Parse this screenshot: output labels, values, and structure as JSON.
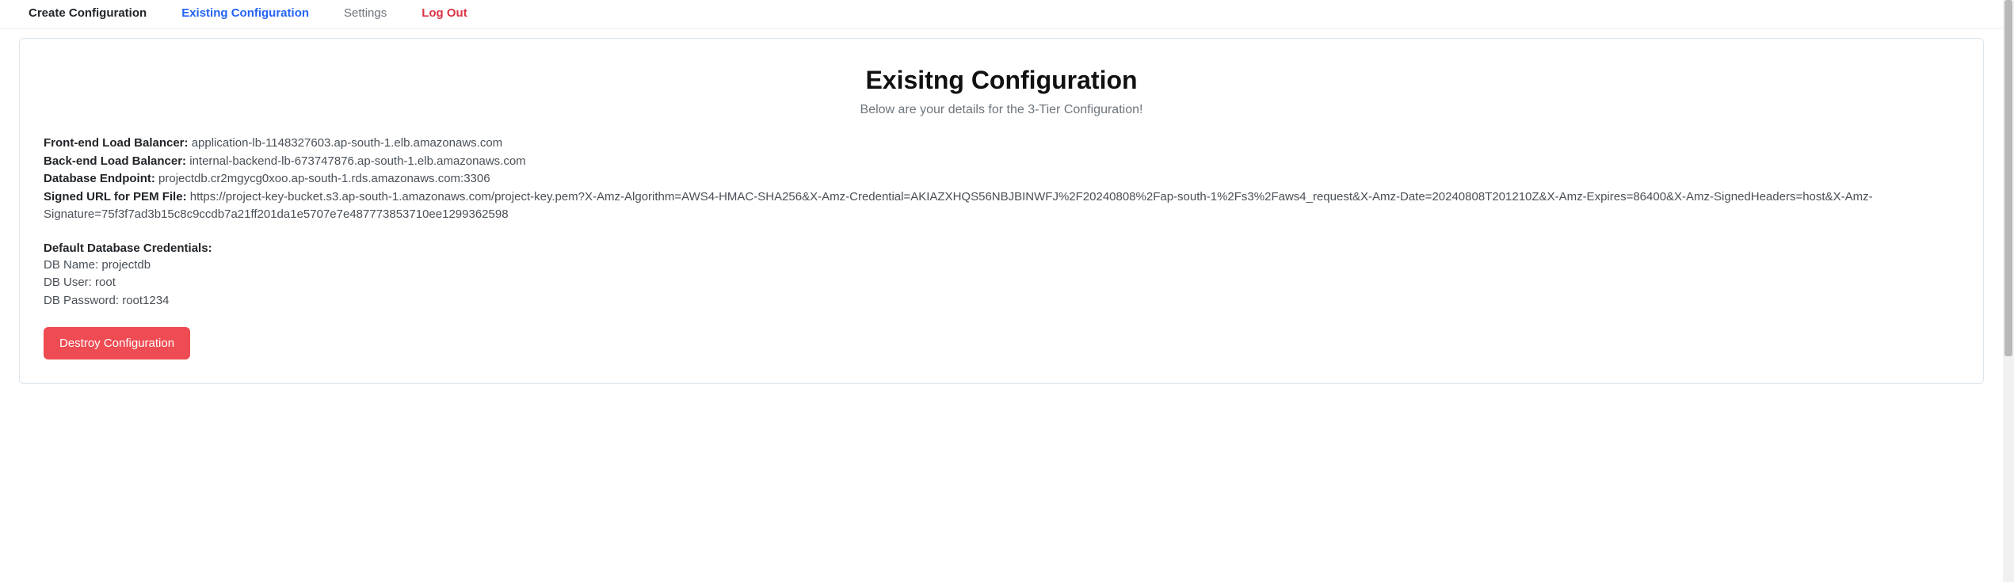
{
  "nav": {
    "create": "Create Configuration",
    "existing": "Existing Configuration",
    "settings": "Settings",
    "logout": "Log Out"
  },
  "page": {
    "title": "Exisitng Configuration",
    "subtitle": "Below are your details for the 3-Tier Configuration!"
  },
  "details": {
    "front_lb_label": "Front-end Load Balancer:",
    "front_lb_value": "application-lb-1148327603.ap-south-1.elb.amazonaws.com",
    "back_lb_label": "Back-end Load Balancer:",
    "back_lb_value": "internal-backend-lb-673747876.ap-south-1.elb.amazonaws.com",
    "db_endpoint_label": "Database Endpoint:",
    "db_endpoint_value": "projectdb.cr2mgycg0xoo.ap-south-1.rds.amazonaws.com:3306",
    "signed_url_label": "Signed URL for PEM File:",
    "signed_url_value": "https://project-key-bucket.s3.ap-south-1.amazonaws.com/project-key.pem?X-Amz-Algorithm=AWS4-HMAC-SHA256&X-Amz-Credential=AKIAZXHQS56NBJBINWFJ%2F20240808%2Fap-south-1%2Fs3%2Faws4_request&X-Amz-Date=20240808T201210Z&X-Amz-Expires=86400&X-Amz-SignedHeaders=host&X-Amz-Signature=75f3f7ad3b15c8c9ccdb7a21ff201da1e5707e7e487773853710ee1299362598"
  },
  "credentials": {
    "title": "Default Database Credentials:",
    "db_name": "DB Name: projectdb",
    "db_user": "DB User: root",
    "db_password": "DB Password: root1234"
  },
  "actions": {
    "destroy": "Destroy Configuration"
  }
}
